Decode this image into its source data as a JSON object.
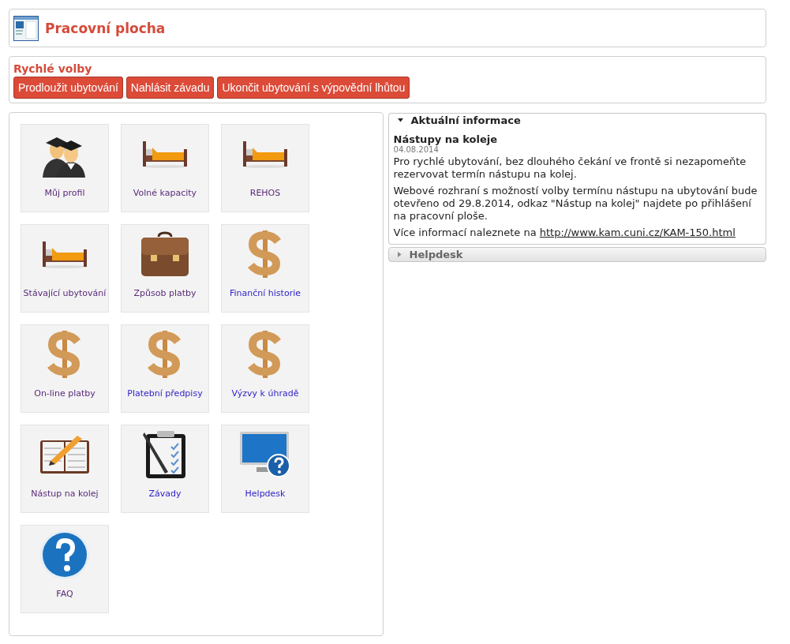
{
  "header": {
    "title": "Pracovní plocha"
  },
  "quick_options": {
    "title": "Rychlé volby",
    "buttons": [
      "Prodloužit ubytování",
      "Nahlásit závadu",
      "Ukončit ubytování s výpovědní lhůtou"
    ]
  },
  "tiles": [
    {
      "label": "Můj profil",
      "kind": "graduates",
      "visited": true
    },
    {
      "label": "Volné kapacity",
      "kind": "bed",
      "visited": true
    },
    {
      "label": "REHOS",
      "kind": "bed",
      "visited": true
    },
    {
      "label": "Stávající ubytování",
      "kind": "bed",
      "visited": true
    },
    {
      "label": "Způsob platby",
      "kind": "briefcase",
      "visited": true
    },
    {
      "label": "Finanční historie",
      "kind": "dollar",
      "visited": false
    },
    {
      "label": "On-line platby",
      "kind": "dollar",
      "visited": true
    },
    {
      "label": "Platební předpisy",
      "kind": "dollar",
      "visited": false
    },
    {
      "label": "Výzvy k úhradě",
      "kind": "dollar",
      "visited": false
    },
    {
      "label": "Nástup na kolej",
      "kind": "planner",
      "visited": true
    },
    {
      "label": "Závady",
      "kind": "clipboard",
      "visited": false
    },
    {
      "label": "Helpdesk",
      "kind": "monitor",
      "visited": false
    },
    {
      "label": "FAQ",
      "kind": "help",
      "visited": true
    }
  ],
  "sections": [
    {
      "title": "Aktuální informace",
      "expanded": true,
      "news": {
        "title": "Nástupy na koleje",
        "date": "04.08.2014",
        "paragraphs": [
          {
            "text": "Pro rychlé ubytování, bez dlouhého čekání ve frontě si nezapomeňte rezervovat termín nástupu na kolej."
          },
          {
            "text": "Webové rozhraní s možností volby termínu nástupu na ubytování bude otevřeno od 29.8.2014, odkaz \"Nástup na kolej\" najdete po přihlášení na pracovní ploše."
          },
          {
            "text": "Více informací naleznete na ",
            "link": "http://www.kam.cuni.cz/KAM-150.html"
          }
        ]
      }
    },
    {
      "title": "Helpdesk",
      "expanded": false
    }
  ]
}
